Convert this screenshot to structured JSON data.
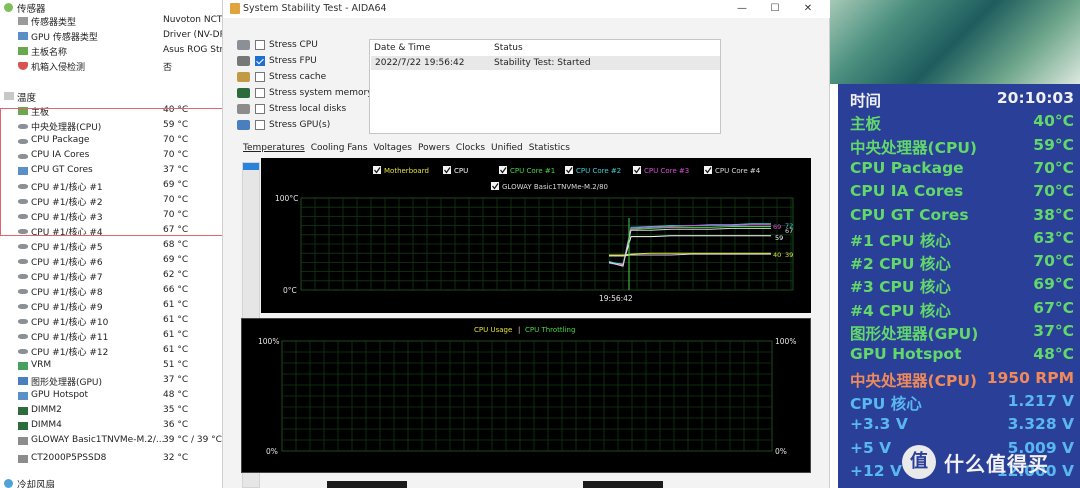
{
  "sensor_panel": {
    "rows": [
      {
        "label": "传感器",
        "value": "",
        "icon": "sensor-icon",
        "level": 0,
        "top": 0
      },
      {
        "label": "传感器类型",
        "value": "Nuvoton NCT6",
        "icon": "sensor-type-icon",
        "level": 1,
        "top": 14
      },
      {
        "label": "GPU 传感器类型",
        "value": "Driver  (NV-DR",
        "icon": "gpu-chip-icon",
        "level": 1,
        "top": 29
      },
      {
        "label": "主板名称",
        "value": "Asus ROG Stri",
        "icon": "motherboard-icon",
        "level": 1,
        "top": 44
      },
      {
        "label": "机箱入侵检测",
        "value": "否",
        "icon": "shield-icon",
        "level": 1,
        "top": 59
      },
      {
        "label": "温度",
        "value": "",
        "icon": "thermometer-icon",
        "level": 0,
        "top": 89
      },
      {
        "label": "主板",
        "value": "40 °C",
        "icon": "motherboard-icon",
        "level": 1,
        "top": 104
      },
      {
        "label": "中央处理器(CPU)",
        "value": "59 °C",
        "icon": "cpu-icon",
        "level": 1,
        "top": 119
      },
      {
        "label": "CPU Package",
        "value": "70 °C",
        "icon": "cpu-icon",
        "level": 1,
        "top": 134
      },
      {
        "label": "CPU IA Cores",
        "value": "70 °C",
        "icon": "cpu-icon",
        "level": 1,
        "top": 149
      },
      {
        "label": "CPU GT Cores",
        "value": "37 °C",
        "icon": "gpu-chip-icon",
        "level": 1,
        "top": 164
      },
      {
        "label": "CPU #1/核心 #1",
        "value": "69 °C",
        "icon": "cpu-icon",
        "level": 1,
        "top": 179
      },
      {
        "label": "CPU #1/核心 #2",
        "value": "70 °C",
        "icon": "cpu-icon",
        "level": 1,
        "top": 194
      },
      {
        "label": "CPU #1/核心 #3",
        "value": "70 °C",
        "icon": "cpu-icon",
        "level": 1,
        "top": 209
      },
      {
        "label": "CPU #1/核心 #4",
        "value": "67 °C",
        "icon": "cpu-icon",
        "level": 1,
        "top": 224
      },
      {
        "label": "CPU #1/核心 #5",
        "value": "68 °C",
        "icon": "cpu-icon",
        "level": 1,
        "top": 239
      },
      {
        "label": "CPU #1/核心 #6",
        "value": "69 °C",
        "icon": "cpu-icon",
        "level": 1,
        "top": 254
      },
      {
        "label": "CPU #1/核心 #7",
        "value": "62 °C",
        "icon": "cpu-icon",
        "level": 1,
        "top": 269
      },
      {
        "label": "CPU #1/核心 #8",
        "value": "66 °C",
        "icon": "cpu-icon",
        "level": 1,
        "top": 284
      },
      {
        "label": "CPU #1/核心 #9",
        "value": "61 °C",
        "icon": "cpu-icon",
        "level": 1,
        "top": 299
      },
      {
        "label": "CPU #1/核心 #10",
        "value": "61 °C",
        "icon": "cpu-icon",
        "level": 1,
        "top": 314
      },
      {
        "label": "CPU #1/核心 #11",
        "value": "61 °C",
        "icon": "cpu-icon",
        "level": 1,
        "top": 329
      },
      {
        "label": "CPU #1/核心 #12",
        "value": "61 °C",
        "icon": "cpu-icon",
        "level": 1,
        "top": 344
      },
      {
        "label": "VRM",
        "value": "51 °C",
        "icon": "vrm-icon",
        "level": 1,
        "top": 359
      },
      {
        "label": "图形处理器(GPU)",
        "value": "37 °C",
        "icon": "gpu-card-icon",
        "level": 1,
        "top": 374
      },
      {
        "label": "GPU Hotspot",
        "value": "48 °C",
        "icon": "gpu-chip-icon",
        "level": 1,
        "top": 389
      },
      {
        "label": "DIMM2",
        "value": "35 °C",
        "icon": "memory-icon",
        "level": 1,
        "top": 404
      },
      {
        "label": "DIMM4",
        "value": "36 °C",
        "icon": "memory-icon",
        "level": 1,
        "top": 419
      },
      {
        "label": "GLOWAY Basic1TNVMe-M.2/...",
        "value": "39 °C / 39 °C",
        "icon": "disk-icon",
        "level": 1,
        "top": 434
      },
      {
        "label": "CT2000P5PSSD8",
        "value": "32 °C",
        "icon": "disk-icon",
        "level": 1,
        "top": 452
      },
      {
        "label": "冷却风扇",
        "value": "",
        "icon": "fan-icon",
        "level": 0,
        "top": 476
      }
    ]
  },
  "aida": {
    "title": "System Stability Test - AIDA64",
    "minimize": "—",
    "maximize": "☐",
    "close": "✕",
    "options": [
      {
        "label": "Stress CPU",
        "checked": false,
        "icon": "cpu-icon"
      },
      {
        "label": "Stress FPU",
        "checked": true,
        "icon": "fpu-icon"
      },
      {
        "label": "Stress cache",
        "checked": false,
        "icon": "cache-icon"
      },
      {
        "label": "Stress system memory",
        "checked": false,
        "icon": "memory-icon"
      },
      {
        "label": "Stress local disks",
        "checked": false,
        "icon": "disk-icon"
      },
      {
        "label": "Stress GPU(s)",
        "checked": false,
        "icon": "gpu-card-icon"
      }
    ],
    "status_table": {
      "headers": [
        "Date & Time",
        "Status"
      ],
      "rows": [
        [
          "2022/7/22 19:56:42",
          "Stability Test: Started"
        ]
      ]
    },
    "tabs": [
      "Temperatures",
      "Cooling Fans",
      "Voltages",
      "Powers",
      "Clocks",
      "Unified",
      "Statistics"
    ],
    "active_tab": "Temperatures"
  },
  "chart_data": [
    {
      "type": "line",
      "legend": [
        {
          "name": "Motherboard",
          "color": "#e2e23a",
          "checked": true
        },
        {
          "name": "CPU",
          "color": "#ffffff",
          "checked": true
        },
        {
          "name": "CPU Core #1",
          "color": "#46d846",
          "checked": true
        },
        {
          "name": "CPU Core #2",
          "color": "#3acfd8",
          "checked": true
        },
        {
          "name": "CPU Core #3",
          "color": "#d84bd8",
          "checked": true
        },
        {
          "name": "CPU Core #4",
          "color": "#d8d8d8",
          "checked": true
        },
        {
          "name": "GLOWAY Basic1TNVMe-M.2/80",
          "color": "#d8d8d8",
          "checked": true
        }
      ],
      "ylim": [
        0,
        100
      ],
      "ytick_labels": [
        "100°C",
        "0°C"
      ],
      "x_label": "19:56:42",
      "right_labels": [
        "69",
        "72",
        "67",
        "59",
        "40",
        "39"
      ],
      "series": [
        {
          "name": "Motherboard",
          "values": [
            38,
            38,
            39,
            40,
            40,
            40,
            40,
            40,
            40,
            40
          ],
          "color": "#e2e23a"
        },
        {
          "name": "CPU",
          "values": [
            30,
            28,
            58,
            58,
            59,
            59,
            59,
            59,
            59,
            59
          ],
          "color": "#ffffff"
        },
        {
          "name": "CPU Core #1",
          "values": [
            30,
            26,
            66,
            67,
            68,
            68,
            68,
            69,
            69,
            69
          ],
          "color": "#46d846"
        },
        {
          "name": "CPU Core #2",
          "values": [
            31,
            27,
            68,
            69,
            70,
            70,
            71,
            71,
            72,
            72
          ],
          "color": "#3acfd8"
        },
        {
          "name": "CPU Core #3",
          "values": [
            29,
            27,
            67,
            68,
            69,
            70,
            70,
            70,
            71,
            71
          ],
          "color": "#d84bd8"
        },
        {
          "name": "CPU Core #4",
          "values": [
            30,
            26,
            65,
            65,
            66,
            66,
            66,
            67,
            67,
            67
          ],
          "color": "#d8d8d8"
        },
        {
          "name": "GLOWAY Basic1TNVMe-M.2/80",
          "values": [
            37,
            37,
            38,
            38,
            38,
            39,
            39,
            39,
            39,
            39
          ],
          "color": "#d8d8d8"
        }
      ]
    },
    {
      "type": "line",
      "legend": [
        {
          "name": "CPU Usage",
          "color": "#e2e23a"
        },
        {
          "name": "CPU Throttling",
          "color": "#46d846"
        }
      ],
      "separator": "|",
      "ylim": [
        0,
        100
      ],
      "ytick_labels": [
        "100%",
        "0%"
      ],
      "right_tick_labels": [
        "100%",
        "0%"
      ],
      "series": []
    }
  ],
  "osd": {
    "rows": [
      {
        "label": "时间",
        "value": "20:10:03",
        "label_color": "#f0f0f0",
        "value_color": "#f0f0f0"
      },
      {
        "label": "主板",
        "value": "40°C",
        "label_color": "#62d86b",
        "value_color": "#62d86b"
      },
      {
        "label": "中央处理器(CPU)",
        "value": "59°C",
        "label_color": "#62d86b",
        "value_color": "#62d86b"
      },
      {
        "label": "CPU Package",
        "value": "70°C",
        "label_color": "#62d86b",
        "value_color": "#62d86b"
      },
      {
        "label": "CPU IA Cores",
        "value": "70°C",
        "label_color": "#62d86b",
        "value_color": "#62d86b"
      },
      {
        "label": "CPU GT Cores",
        "value": "38°C",
        "label_color": "#62d86b",
        "value_color": "#62d86b"
      },
      {
        "label": " #1 CPU 核心",
        "value": "63°C",
        "label_color": "#62d86b",
        "value_color": "#62d86b"
      },
      {
        "label": " #2 CPU 核心",
        "value": "70°C",
        "label_color": "#62d86b",
        "value_color": "#62d86b"
      },
      {
        "label": " #3 CPU 核心",
        "value": "69°C",
        "label_color": "#62d86b",
        "value_color": "#62d86b"
      },
      {
        "label": " #4 CPU 核心",
        "value": "67°C",
        "label_color": "#62d86b",
        "value_color": "#62d86b"
      },
      {
        "label": "图形处理器(GPU)",
        "value": "37°C",
        "label_color": "#62d86b",
        "value_color": "#62d86b"
      },
      {
        "label": "GPU Hotspot",
        "value": "48°C",
        "label_color": "#62d86b",
        "value_color": "#62d86b"
      },
      {
        "label": "中央处理器(CPU)",
        "value": "1950 RPM",
        "label_color": "#f08a5a",
        "value_color": "#f08a5a"
      },
      {
        "label": "CPU 核心",
        "value": "1.217 V",
        "label_color": "#5ab8f0",
        "value_color": "#5ab8f0"
      },
      {
        "label": "+3.3 V",
        "value": "3.328 V",
        "label_color": "#5ab8f0",
        "value_color": "#5ab8f0"
      },
      {
        "label": "+5 V",
        "value": "5.009 V",
        "label_color": "#5ab8f0",
        "value_color": "#5ab8f0"
      },
      {
        "label": "+12 V",
        "value": "12.000 V",
        "label_color": "#5ab8f0",
        "value_color": "#5ab8f0"
      }
    ]
  },
  "watermark": {
    "mark": "值",
    "text": "什么值得买"
  }
}
